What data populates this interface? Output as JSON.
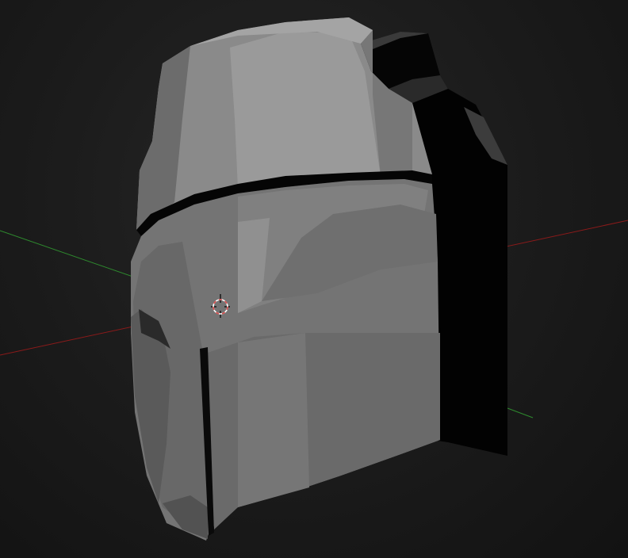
{
  "viewport": {
    "background": "#1c1c1c",
    "axes": {
      "x_axis_color": "#8b1a1a",
      "y_axis_color": "#2e8b2e"
    },
    "cursor": {
      "icon": "3d-cursor-icon",
      "ring_colors": [
        "#d94b4b",
        "#ffffff"
      ]
    },
    "object": {
      "type": "helmet mesh",
      "shading": "solid-gray"
    }
  }
}
